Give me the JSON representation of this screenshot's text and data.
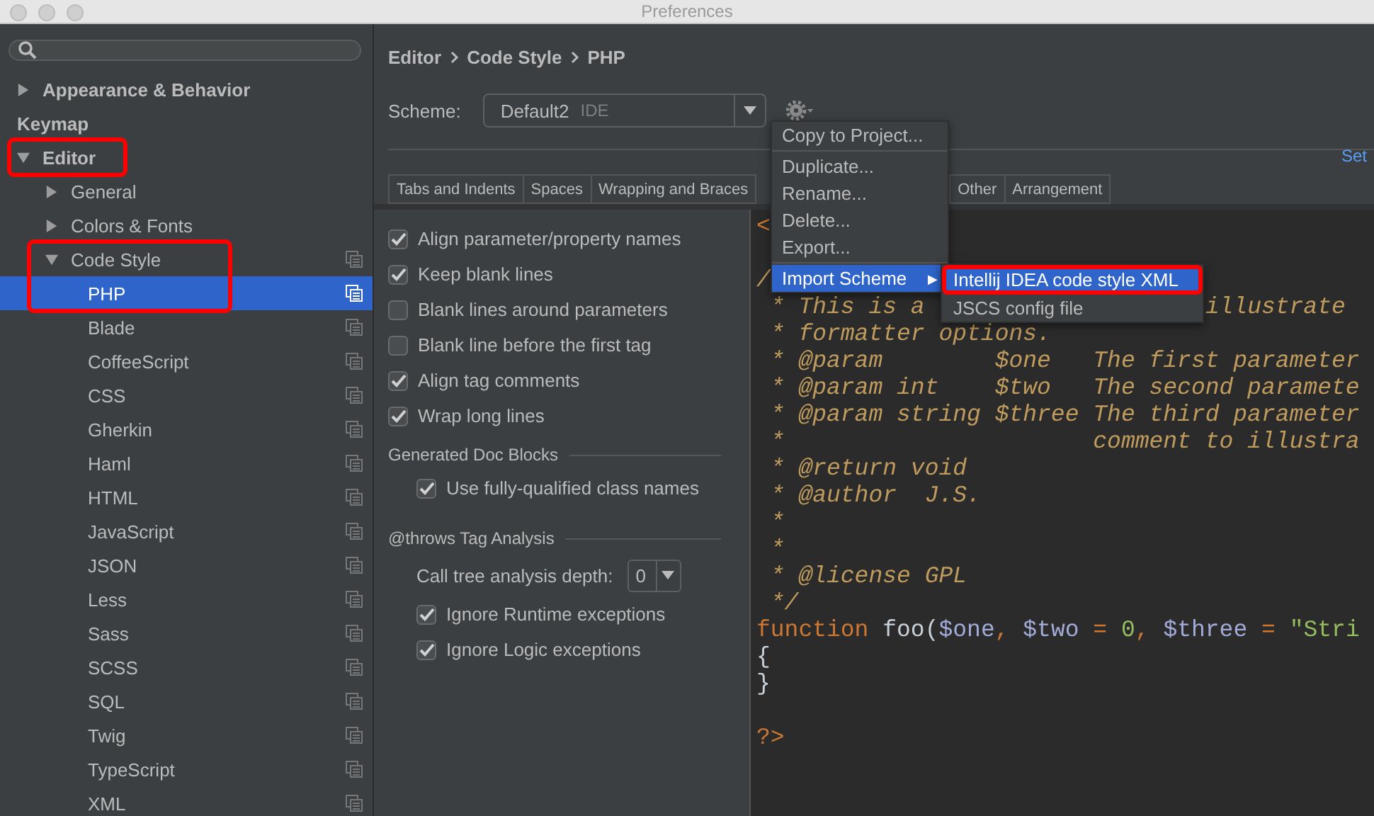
{
  "window": {
    "title": "Preferences"
  },
  "sidebar": {
    "items": [
      {
        "label": "Appearance & Behavior",
        "expanded": false
      },
      {
        "label": "Keymap"
      },
      {
        "label": "Editor",
        "expanded": true,
        "outlined": true,
        "children": [
          {
            "label": "General",
            "expanded": false
          },
          {
            "label": "Colors & Fonts",
            "expanded": false
          },
          {
            "label": "Code Style",
            "expanded": true,
            "outlined": true,
            "scheme_icon": true,
            "children": [
              {
                "label": "PHP",
                "selected": true,
                "outlined": true,
                "scheme_icon": true
              },
              {
                "label": "Blade",
                "selected": false,
                "scheme_icon": true
              },
              {
                "label": "CoffeeScript",
                "selected": false,
                "scheme_icon": true
              },
              {
                "label": "CSS",
                "selected": false,
                "scheme_icon": true
              },
              {
                "label": "Gherkin",
                "selected": false,
                "scheme_icon": true
              },
              {
                "label": "Haml",
                "selected": false,
                "scheme_icon": true
              },
              {
                "label": "HTML",
                "selected": false,
                "scheme_icon": true
              },
              {
                "label": "JavaScript",
                "selected": false,
                "scheme_icon": true
              },
              {
                "label": "JSON",
                "selected": false,
                "scheme_icon": true
              },
              {
                "label": "Less",
                "selected": false,
                "scheme_icon": true
              },
              {
                "label": "Sass",
                "selected": false,
                "scheme_icon": true
              },
              {
                "label": "SCSS",
                "selected": false,
                "scheme_icon": true
              },
              {
                "label": "SQL",
                "selected": false,
                "scheme_icon": true
              },
              {
                "label": "Twig",
                "selected": false,
                "scheme_icon": true
              },
              {
                "label": "TypeScript",
                "selected": false,
                "scheme_icon": true
              },
              {
                "label": "XML",
                "selected": false,
                "scheme_icon": true
              }
            ]
          }
        ]
      }
    ]
  },
  "breadcrumb": [
    "Editor",
    "Code Style",
    "PHP"
  ],
  "scheme": {
    "label": "Scheme:",
    "value": "Default2",
    "tag": "IDE"
  },
  "set_link": "Set",
  "tabs_left": [
    "Tabs and Indents",
    "Spaces",
    "Wrapping and Braces"
  ],
  "tabs_right": [
    "Other",
    "Arrangement"
  ],
  "options": [
    {
      "label": "Align parameter/property names",
      "checked": true
    },
    {
      "label": "Keep blank lines",
      "checked": true
    },
    {
      "label": "Blank lines around parameters",
      "checked": false
    },
    {
      "label": "Blank line before the first tag",
      "checked": false
    },
    {
      "label": "Align tag comments",
      "checked": true
    },
    {
      "label": "Wrap long lines",
      "checked": true
    }
  ],
  "groups": [
    {
      "title": "Generated Doc Blocks",
      "options": [
        {
          "label": "Use fully-qualified class names",
          "checked": true
        }
      ]
    },
    {
      "title": "@throws Tag Analysis",
      "depth": {
        "label": "Call tree analysis depth:",
        "value": "0"
      },
      "options": [
        {
          "label": "Ignore Runtime exceptions",
          "checked": true
        },
        {
          "label": "Ignore Logic exceptions",
          "checked": true
        }
      ]
    }
  ],
  "code": [
    [
      {
        "text": "<",
        "kind": "tag"
      }
    ],
    [
      {
        "text": "/",
        "kind": "comment",
        "blank_before": true
      }
    ],
    [
      {
        "text": " * This is a",
        "kind": "comment"
      },
      {
        "text": "illustrate",
        "kind": "comment",
        "after_gap": true
      }
    ],
    [
      {
        "text": " * formatter options.",
        "kind": "comment"
      }
    ],
    [
      {
        "text": " * @param        $one   The first parameter",
        "kind": "comment"
      }
    ],
    [
      {
        "text": " * @param int    $two   The second paramete",
        "kind": "comment"
      }
    ],
    [
      {
        "text": " * @param string $three The third parameter",
        "kind": "comment"
      }
    ],
    [
      {
        "text": " *                      comment to illustra",
        "kind": "comment"
      }
    ],
    [
      {
        "text": " * @return void",
        "kind": "comment"
      }
    ],
    [
      {
        "text": " * @author  J.S.",
        "kind": "comment"
      }
    ],
    [
      {
        "text": " *",
        "kind": "comment"
      }
    ],
    [
      {
        "text": " *",
        "kind": "comment"
      }
    ],
    [
      {
        "text": " * @license GPL",
        "kind": "comment"
      }
    ],
    [
      {
        "text": " */",
        "kind": "comment"
      }
    ],
    [
      {
        "text": "function",
        "kind": "keyword"
      },
      {
        "text": " foo(",
        "kind": "plain"
      },
      {
        "text": "$one",
        "kind": "variable"
      },
      {
        "text": ", ",
        "kind": "keyword"
      },
      {
        "text": "$two",
        "kind": "variable"
      },
      {
        "text": " = ",
        "kind": "keyword"
      },
      {
        "text": "0",
        "kind": "number"
      },
      {
        "text": ", ",
        "kind": "keyword"
      },
      {
        "text": "$three",
        "kind": "variable"
      },
      {
        "text": " = ",
        "kind": "keyword"
      },
      {
        "text": "\"Stri",
        "kind": "string"
      }
    ],
    [
      {
        "text": "{",
        "kind": "plain"
      }
    ],
    [
      {
        "text": "}",
        "kind": "plain"
      }
    ],
    [
      {
        "text": "?>",
        "kind": "tag",
        "blank_before": true
      }
    ]
  ],
  "menu": {
    "items": [
      {
        "kind": "item",
        "label": "Copy to Project...",
        "selected": false
      },
      {
        "kind": "separator"
      },
      {
        "kind": "item",
        "label": "Duplicate...",
        "selected": false
      },
      {
        "kind": "item",
        "label": "Rename...",
        "selected": false
      },
      {
        "kind": "item",
        "label": "Delete...",
        "selected": false
      },
      {
        "kind": "item",
        "label": "Export...",
        "selected": false
      },
      {
        "kind": "separator"
      },
      {
        "kind": "submenu",
        "label": "Import Scheme",
        "arrow": "▶",
        "selected": true,
        "children": [
          {
            "label": "Intellij IDEA code style XML",
            "selected": true,
            "outlined": true
          },
          {
            "label": "JSCS config file",
            "selected": false
          }
        ]
      }
    ]
  }
}
